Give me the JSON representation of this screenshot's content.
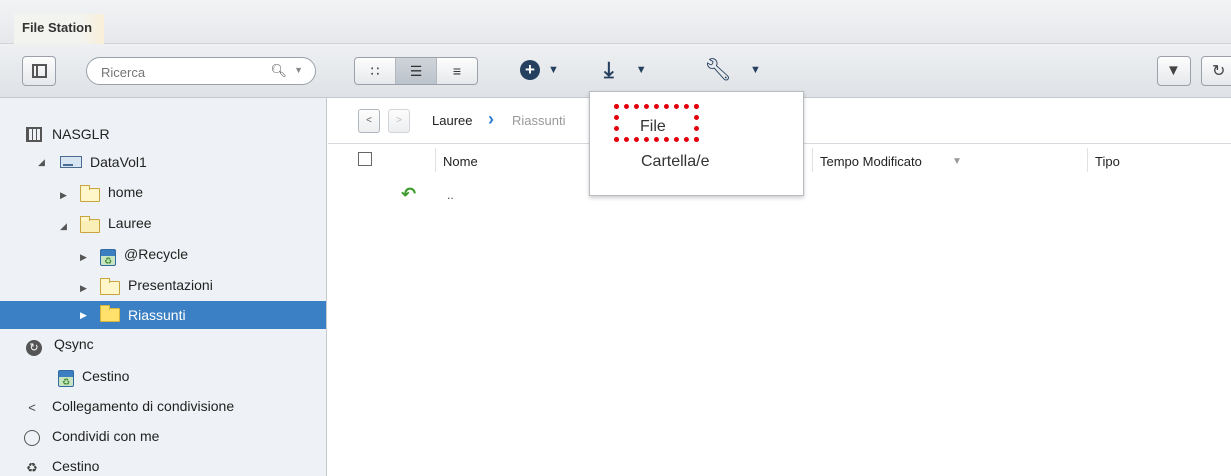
{
  "window": {
    "title": "File Station"
  },
  "toolbar": {
    "search_placeholder": "Ricerca",
    "view_modes": [
      "thumbnail",
      "list",
      "detail"
    ],
    "icons": {
      "sidebar_toggle": "sidebar-toggle-icon",
      "search": "search-icon",
      "create": "plus-circle-icon",
      "upload": "upload-icon",
      "tools": "wrench-icon",
      "filter": "filter-icon",
      "refresh": "refresh-icon"
    }
  },
  "upload_menu": {
    "items": [
      {
        "label": "File",
        "highlighted": true
      },
      {
        "label": "Cartella/e",
        "highlighted": false
      }
    ],
    "highlight_color": "#e3000b"
  },
  "sidebar": {
    "root": "NASGLR",
    "volume": "DataVol1",
    "folders": [
      {
        "label": "home",
        "level": 1
      },
      {
        "label": "Lauree",
        "level": 1,
        "expanded": true
      },
      {
        "label": "@Recycle",
        "level": 2
      },
      {
        "label": "Presentazioni",
        "level": 2
      },
      {
        "label": "Riassunti",
        "level": 2,
        "selected": true
      }
    ],
    "extras": [
      {
        "label": "Qsync",
        "icon": "qsync-icon"
      },
      {
        "label": "Cestino",
        "icon": "recycle-bin-icon"
      },
      {
        "label": "Collegamento di condivisione",
        "icon": "share-link-icon"
      },
      {
        "label": "Condividi con me",
        "icon": "shared-with-me-icon"
      },
      {
        "label": "Cestino",
        "icon": "recycle-icon"
      }
    ],
    "selected_color": "#3b7fc4"
  },
  "content": {
    "breadcrumb": {
      "parent": "Lauree",
      "current": "Riassunti"
    },
    "columns": {
      "name": "Nome",
      "modified": "Tempo Modificato",
      "type": "Tipo"
    },
    "rows": [
      {
        "name": ".."
      }
    ]
  }
}
